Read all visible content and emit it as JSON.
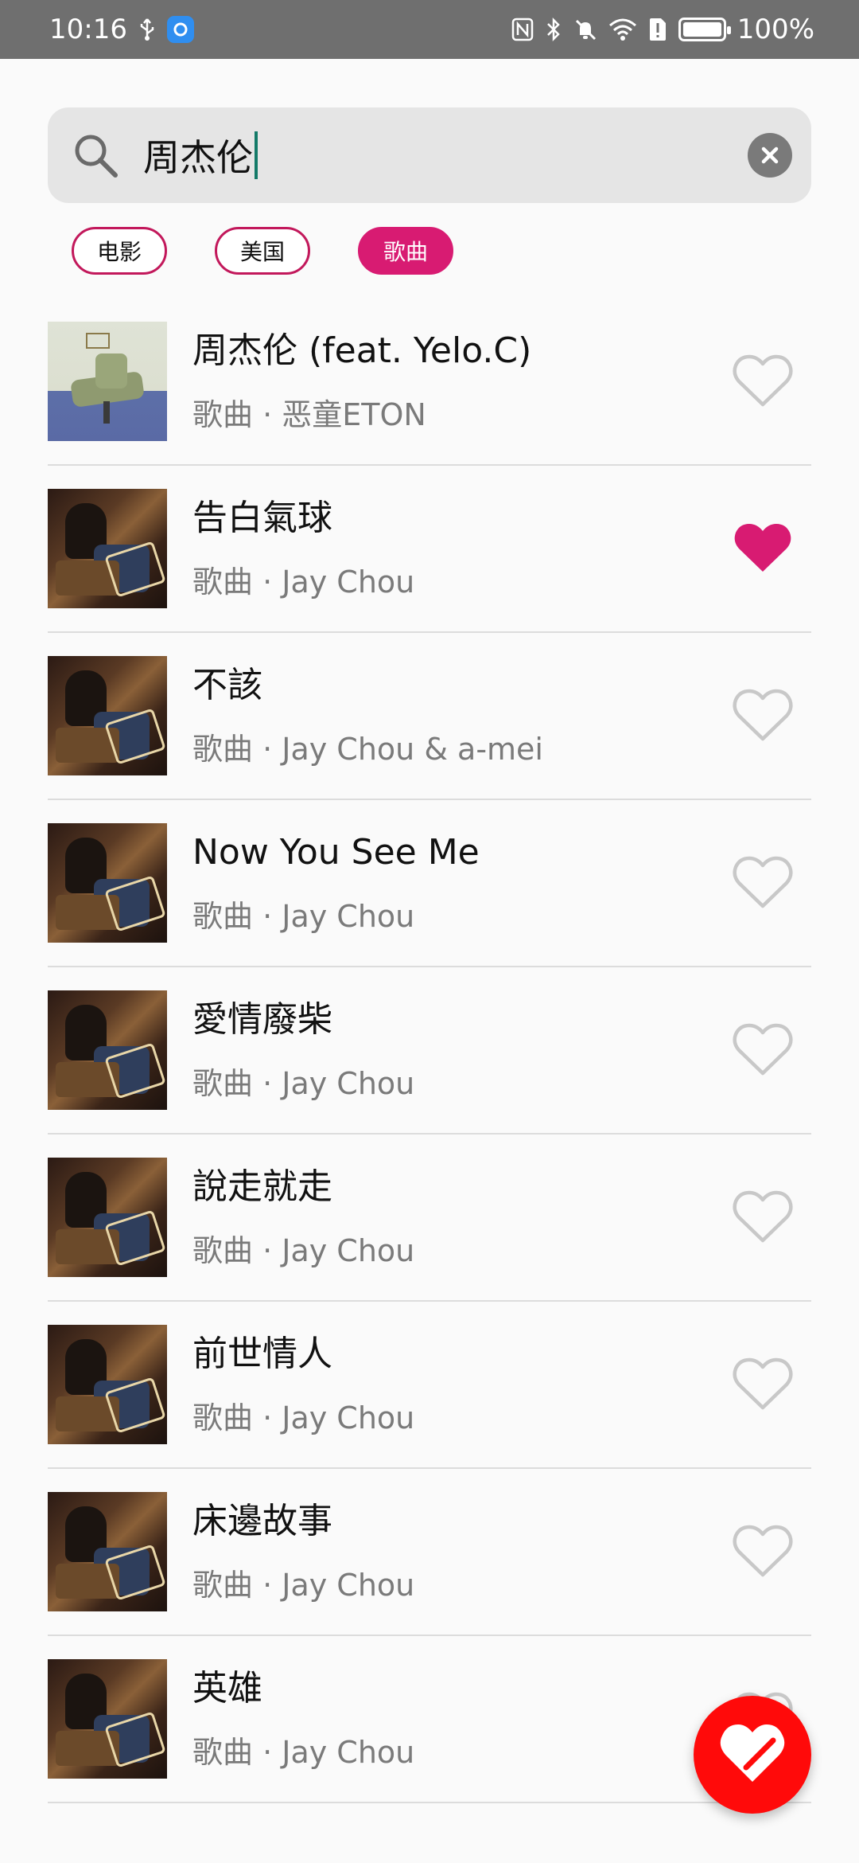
{
  "status_bar": {
    "time": "10:16",
    "battery": "100%"
  },
  "search": {
    "value": "周杰伦"
  },
  "chips": [
    {
      "label": "电影",
      "active": false
    },
    {
      "label": "美国",
      "active": false
    },
    {
      "label": "歌曲",
      "active": true
    }
  ],
  "results": [
    {
      "title": "周杰伦 (feat. Yelo.C)",
      "subtitle": "歌曲 · 恶童ETON",
      "liked": false,
      "art": "chair"
    },
    {
      "title": "告白氣球",
      "subtitle": "歌曲 · Jay Chou",
      "liked": true,
      "art": "album"
    },
    {
      "title": "不該",
      "subtitle": "歌曲 · Jay Chou & a-mei",
      "liked": false,
      "art": "album"
    },
    {
      "title": "Now You See Me",
      "subtitle": "歌曲 · Jay Chou",
      "liked": false,
      "art": "album"
    },
    {
      "title": "愛情廢柴",
      "subtitle": "歌曲 · Jay Chou",
      "liked": false,
      "art": "album"
    },
    {
      "title": "說走就走",
      "subtitle": "歌曲 · Jay Chou",
      "liked": false,
      "art": "album"
    },
    {
      "title": "前世情人",
      "subtitle": "歌曲 · Jay Chou",
      "liked": false,
      "art": "album"
    },
    {
      "title": "床邊故事",
      "subtitle": "歌曲 · Jay Chou",
      "liked": false,
      "art": "album"
    },
    {
      "title": "英雄",
      "subtitle": "歌曲 · Jay Chou",
      "liked": false,
      "art": "album"
    }
  ],
  "colors": {
    "accent": "#d81b72",
    "fab": "#ff0a0a",
    "status_bar": "#6f6f6f"
  },
  "icons": {
    "search": "search-icon",
    "clear": "clear-icon",
    "like": "heart-icon",
    "fab": "favorites-heart-icon"
  }
}
